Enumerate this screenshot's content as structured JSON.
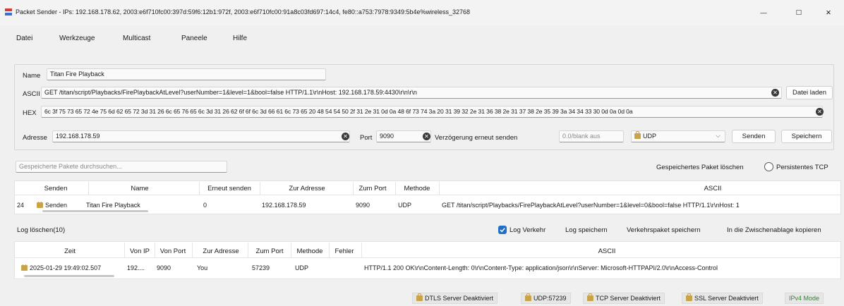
{
  "window": {
    "title": "Packet Sender - IPs: 192.168.178.62, 2003:e6f710fc00:397d:59f6:12b1:972f, 2003:e6f710fc00:91a8c03fd697:14c4, fe80::a753:7978:9349:5b4e%wireless_32768",
    "minimize": "—",
    "maximize": "☐",
    "close": "✕"
  },
  "menu": [
    "Datei",
    "Werkzeuge",
    "Multicast",
    "Paneele",
    "Hilfe"
  ],
  "form": {
    "name_label": "Name",
    "name_value": "Titan Fire Playback",
    "ascii_label": "ASCII",
    "ascii_value": "GET /titan/script/Playbacks/FirePlaybackAtLevel?userNumber=1&level=1&bool=false HTTP/1.1\\r\\nHost: 192.168.178.59:4430\\r\\n\\r\\n",
    "load_file_label": "Datei laden",
    "hex_label": "HEX",
    "hex_value": "6c 3f 75 73 65 72 4e 75 6d 62 65 72 3d 31 26 6c 65 76 65 6c 3d 31 26 62 6f 6f 6c 3d 66 61 6c 73 65 20 48 54 54 50 2f 31 2e 31 0d 0a 48 6f 73 74 3a 20 31 39 32 2e 31 36 38 2e 31 37 38 2e 35 39 3a 34 34 33 30 0d 0a 0d 0a",
    "address_label": "Adresse",
    "address_value": "192.168.178.59",
    "port_label": "Port",
    "port_value": "9090",
    "resend_label": "Verzögerung erneut senden",
    "resend_placeholder": "0.0/blank aus",
    "protocol_value": "UDP",
    "send_label": "Senden",
    "save_label": "Speichern",
    "clear_glyph": "✕",
    "chevron_glyph": "⌵"
  },
  "saved": {
    "search_placeholder": "Gespeicherte Pakete durchsuchen...",
    "delete_label": "Gespeichertes Paket löschen",
    "persistent_label": "Persistentes TCP",
    "headers": [
      "Senden",
      "Name",
      "Erneut senden",
      "Zur Adresse",
      "Zum Port",
      "Methode",
      "ASCII"
    ],
    "rows": [
      {
        "index": "24",
        "send": "Senden",
        "name": "Titan Fire Playback",
        "resend": "0",
        "address": "192.168.178.59",
        "port": "9090",
        "method": "UDP",
        "ascii": "GET /titan/script/Playbacks/FirePlaybackAtLevel?userNumber=1&level=0&bool=false HTTP/1.1\\r\\nHost: 1"
      }
    ]
  },
  "log": {
    "clear_label": "Log löschen(10)",
    "log_traffic_label": "Log Verkehr",
    "log_traffic_checked": true,
    "save_log_label": "Log speichern",
    "save_traffic_label": "Verkehrspaket speichern",
    "copy_clipboard_label": "In die Zwischenablage kopieren",
    "headers": [
      "Zeit",
      "Von IP",
      "Von Port",
      "Zur Adresse",
      "Zum Port",
      "Methode",
      "Fehler",
      "ASCII"
    ],
    "rows": [
      {
        "time": "2025-01-29 19:49:02.507",
        "from_ip": "192....",
        "from_port": "9090",
        "to_address": "You",
        "to_port": "57239",
        "method": "UDP",
        "error": "",
        "ascii": "HTTP/1.1 200 OK\\r\\nContent-Length: 0\\r\\nContent-Type: application/json\\r\\nServer: Microsoft-HTTPAPI/2.0\\r\\nAccess-Control"
      }
    ]
  },
  "status": {
    "dtls": "DTLS Server Deaktiviert",
    "udp": "UDP:57239",
    "tcp": "TCP Server Deaktiviert",
    "ssl": "SSL Server Deaktiviert",
    "ipv4": "IPv4 Mode"
  },
  "colors": {
    "accent": "#1f6fc5",
    "ipv4_green": "#2e8b2e",
    "lock_gold": "#c9a34a"
  }
}
